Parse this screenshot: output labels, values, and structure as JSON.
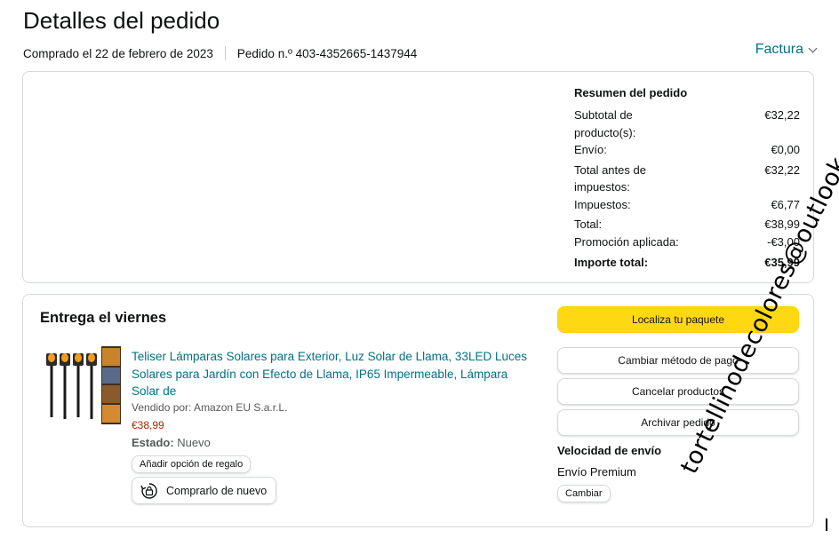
{
  "page": {
    "title": "Detalles del pedido",
    "purchased": "Comprado el 22 de febrero de 2023",
    "order_number": "Pedido n.º 403-4352665-1437944",
    "invoice_label": "Factura"
  },
  "summary": {
    "title": "Resumen del pedido",
    "rows": [
      {
        "label": "Subtotal de producto(s):",
        "value": "€32,22"
      },
      {
        "label": "Envío:",
        "value": "€0,00"
      },
      {
        "label": "Total antes de impuestos:",
        "value": "€32,22"
      },
      {
        "label": "Impuestos:",
        "value": "€6,77"
      },
      {
        "label": "Total:",
        "value": "€38,99"
      },
      {
        "label": "Promoción aplicada:",
        "value": "-€3,00"
      }
    ],
    "grand_total": {
      "label": "Importe total:",
      "value": "€35,99"
    }
  },
  "delivery": {
    "title": "Entrega el viernes",
    "product": {
      "title": "Teliser Lámparas Solares para Exterior, Luz Solar de Llama, 33LED Luces Solares para Jardín con Efecto de Llama, IP65 Impermeable, Lámpara Solar de",
      "seller": "Vendido por: Amazon EU S.a.r.L.",
      "price": "€38,99",
      "status_label": "Estado:",
      "status_value": "Nuevo"
    },
    "gift_button": "Añadir opción de regalo",
    "buy_again": "Comprarlo de nuevo",
    "actions": {
      "track": "Localiza tu paquete",
      "change_payment": "Cambiar método de pago",
      "cancel": "Cancelar productos",
      "archive": "Archivar pedido"
    },
    "speed": {
      "title": "Velocidad de envío",
      "value": "Envío Premium",
      "change": "Cambiar"
    }
  },
  "watermark": "tortellinodecolores@outlook.es",
  "colors": {
    "link": "#007185",
    "price": "#b12704",
    "primary_button": "#ffd814"
  }
}
